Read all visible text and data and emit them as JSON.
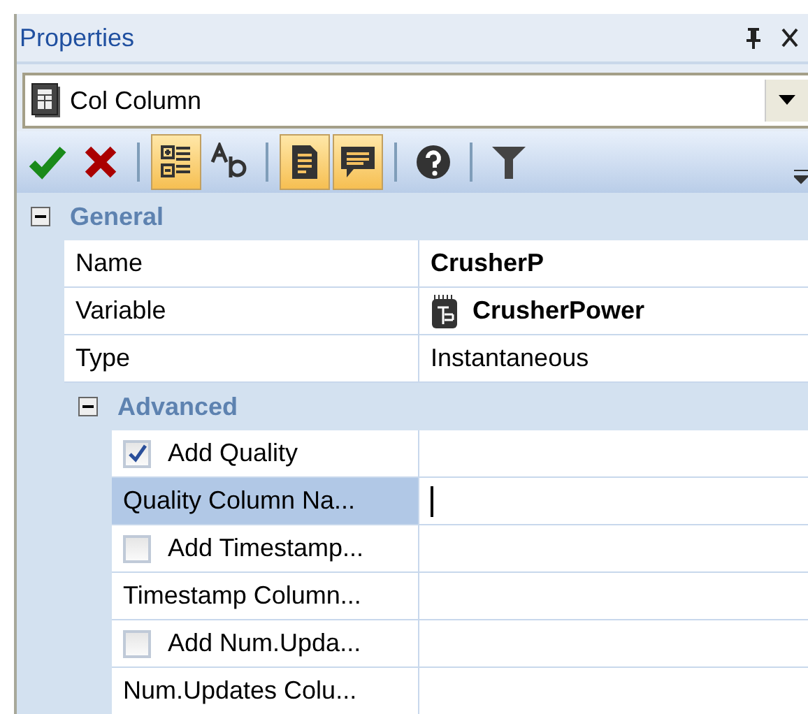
{
  "panel": {
    "title": "Properties"
  },
  "object_selector": {
    "value": "Col Column"
  },
  "toolbar": [
    {
      "kind": "ok"
    },
    {
      "kind": "cancel"
    },
    {
      "kind": "sep"
    },
    {
      "kind": "categorized",
      "selected": true
    },
    {
      "kind": "alphabetical",
      "selected": false
    },
    {
      "kind": "sep"
    },
    {
      "kind": "pages",
      "selected": true
    },
    {
      "kind": "description",
      "selected": true
    },
    {
      "kind": "sep"
    },
    {
      "kind": "help"
    },
    {
      "kind": "sep"
    },
    {
      "kind": "filter"
    }
  ],
  "categories": [
    {
      "label": "General",
      "expanded": true,
      "children": [
        {
          "kind": "property",
          "name": "Name",
          "value": "CrusherP",
          "bold": true,
          "selected": false
        },
        {
          "kind": "property",
          "name": "Variable",
          "value": "CrusherPower",
          "bold": true,
          "icon": true,
          "selected": false
        },
        {
          "kind": "property",
          "name": "Type",
          "value": "Instantaneous",
          "bold": false,
          "selected": false
        },
        {
          "kind": "category",
          "label": "Advanced",
          "expanded": true,
          "children": [
            {
              "kind": "checkbox",
              "name": "Add Quality",
              "checked": true,
              "selected": false
            },
            {
              "kind": "property",
              "name": "Quality Column Na...",
              "editing": true,
              "selected": true
            },
            {
              "kind": "checkbox",
              "name": "Add Timestamp...",
              "checked": false,
              "selected": false
            },
            {
              "kind": "property",
              "name": "Timestamp Column...",
              "selected": false
            },
            {
              "kind": "checkbox",
              "name": "Add Num.Upda...",
              "checked": false,
              "selected": false
            },
            {
              "kind": "property",
              "name": "Num.Updates Colu...",
              "selected": false
            }
          ]
        }
      ]
    }
  ]
}
